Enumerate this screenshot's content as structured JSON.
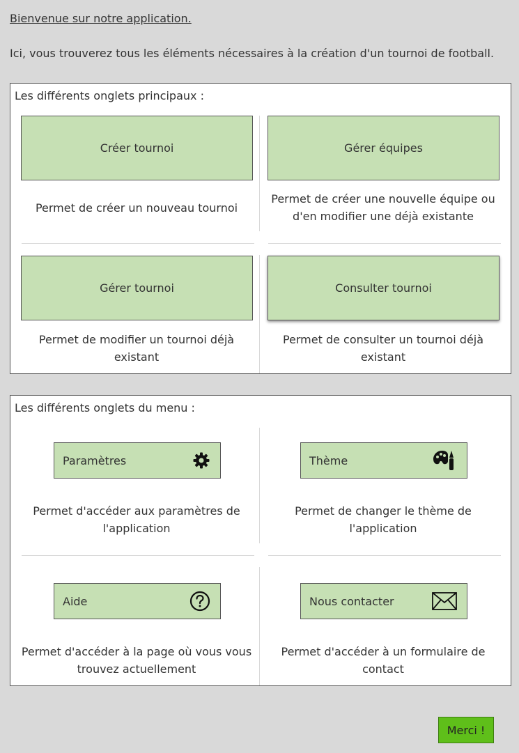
{
  "header": {
    "welcome": "Bienvenue sur notre application.",
    "intro": "Ici, vous trouverez tous les éléments nécessaires à la création d'un tournoi de football."
  },
  "main_tabs": {
    "title": "Les différents onglets principaux :",
    "items": [
      {
        "label": "Créer tournoi",
        "desc": "Permet de créer un nouveau tournoi"
      },
      {
        "label": "Gérer équipes",
        "desc": "Permet de créer une nouvelle équipe ou d'en modifier une déjà existante"
      },
      {
        "label": "Gérer tournoi",
        "desc": "Permet de modifier un tournoi déjà existant"
      },
      {
        "label": "Consulter tournoi",
        "desc": "Permet de consulter un tournoi déjà existant"
      }
    ]
  },
  "menu_tabs": {
    "title": "Les différents onglets du menu :",
    "items": [
      {
        "label": "Paramètres",
        "icon": "gear-icon",
        "desc": "Permet d'accéder aux paramètres de l'application"
      },
      {
        "label": "Thème",
        "icon": "palette-icon",
        "desc": "Permet de changer le thème de l'application"
      },
      {
        "label": "Aide",
        "icon": "help-icon",
        "desc": "Permet d'accéder à la page où vous vous trouvez actuellement"
      },
      {
        "label": "Nous contacter",
        "icon": "mail-icon",
        "desc": "Permet d'accéder à un formulaire de contact"
      }
    ]
  },
  "footer": {
    "merci_label": "Merci !"
  },
  "colors": {
    "background": "#d9d9d9",
    "button_green": "#c6e0b4",
    "merci_green": "#5fbf1a"
  }
}
